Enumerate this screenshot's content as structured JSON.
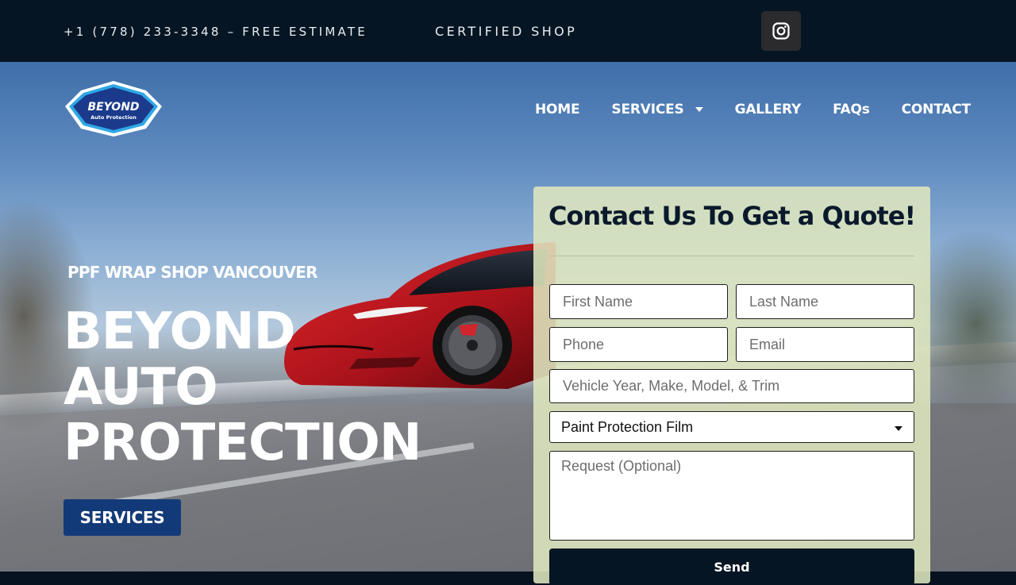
{
  "topbar": {
    "phone": "+1 (778) 233-3348 – FREE ESTIMATE",
    "certified": "CERTIFIED SHOP",
    "social_icon": "instagram-icon"
  },
  "logo": {
    "name": "BEYOND",
    "tagline": "Auto Protection"
  },
  "nav": {
    "items": [
      {
        "label": "HOME"
      },
      {
        "label": "SERVICES",
        "has_dropdown": true
      },
      {
        "label": "GALLERY"
      },
      {
        "label": "FAQs"
      },
      {
        "label": "CONTACT"
      }
    ]
  },
  "hero": {
    "kicker": "PPF WRAP SHOP VANCOUVER",
    "headline": [
      "BEYOND",
      "AUTO",
      "PROTECTION"
    ],
    "cta": "SERVICES"
  },
  "form": {
    "title": "Contact Us To Get a Quote!",
    "fields": {
      "first_name": "First Name",
      "last_name": "Last Name",
      "phone": "Phone",
      "email": "Email",
      "vehicle": "Vehicle Year, Make, Model, & Trim",
      "request": "Request (Optional)"
    },
    "service_selected": "Paint Protection Film",
    "submit": "Send"
  },
  "colors": {
    "topbar_bg": "#061523",
    "cta_bg": "#133a78",
    "card_bg": "#dee6be",
    "send_bg": "#061523",
    "logo_blue": "#1b3a8c"
  }
}
